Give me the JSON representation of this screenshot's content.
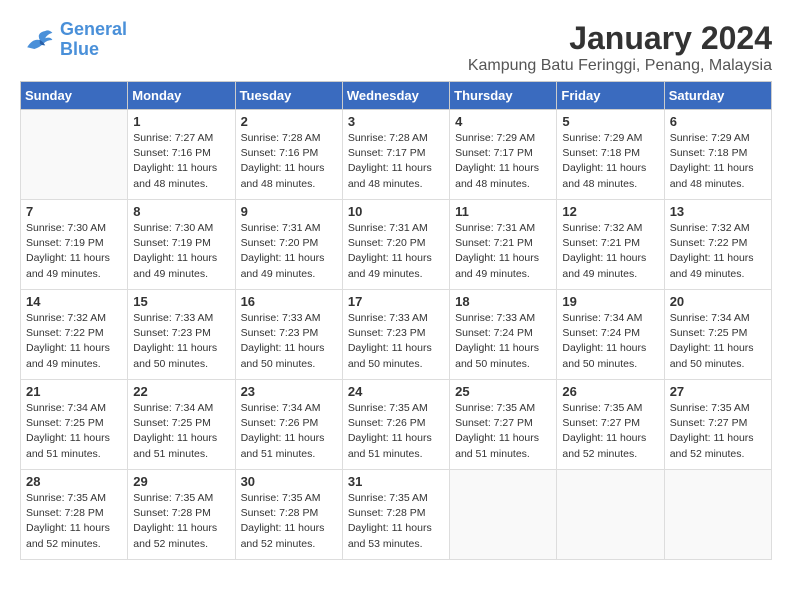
{
  "logo": {
    "text_general": "General",
    "text_blue": "Blue"
  },
  "title": "January 2024",
  "subtitle": "Kampung Batu Feringgi, Penang, Malaysia",
  "days_of_week": [
    "Sunday",
    "Monday",
    "Tuesday",
    "Wednesday",
    "Thursday",
    "Friday",
    "Saturday"
  ],
  "weeks": [
    [
      {
        "day": null
      },
      {
        "day": "1",
        "sunrise": "7:27 AM",
        "sunset": "7:16 PM",
        "daylight": "11 hours and 48 minutes."
      },
      {
        "day": "2",
        "sunrise": "7:28 AM",
        "sunset": "7:16 PM",
        "daylight": "11 hours and 48 minutes."
      },
      {
        "day": "3",
        "sunrise": "7:28 AM",
        "sunset": "7:17 PM",
        "daylight": "11 hours and 48 minutes."
      },
      {
        "day": "4",
        "sunrise": "7:29 AM",
        "sunset": "7:17 PM",
        "daylight": "11 hours and 48 minutes."
      },
      {
        "day": "5",
        "sunrise": "7:29 AM",
        "sunset": "7:18 PM",
        "daylight": "11 hours and 48 minutes."
      },
      {
        "day": "6",
        "sunrise": "7:29 AM",
        "sunset": "7:18 PM",
        "daylight": "11 hours and 48 minutes."
      }
    ],
    [
      {
        "day": "7",
        "sunrise": "7:30 AM",
        "sunset": "7:19 PM",
        "daylight": "11 hours and 49 minutes."
      },
      {
        "day": "8",
        "sunrise": "7:30 AM",
        "sunset": "7:19 PM",
        "daylight": "11 hours and 49 minutes."
      },
      {
        "day": "9",
        "sunrise": "7:31 AM",
        "sunset": "7:20 PM",
        "daylight": "11 hours and 49 minutes."
      },
      {
        "day": "10",
        "sunrise": "7:31 AM",
        "sunset": "7:20 PM",
        "daylight": "11 hours and 49 minutes."
      },
      {
        "day": "11",
        "sunrise": "7:31 AM",
        "sunset": "7:21 PM",
        "daylight": "11 hours and 49 minutes."
      },
      {
        "day": "12",
        "sunrise": "7:32 AM",
        "sunset": "7:21 PM",
        "daylight": "11 hours and 49 minutes."
      },
      {
        "day": "13",
        "sunrise": "7:32 AM",
        "sunset": "7:22 PM",
        "daylight": "11 hours and 49 minutes."
      }
    ],
    [
      {
        "day": "14",
        "sunrise": "7:32 AM",
        "sunset": "7:22 PM",
        "daylight": "11 hours and 49 minutes."
      },
      {
        "day": "15",
        "sunrise": "7:33 AM",
        "sunset": "7:23 PM",
        "daylight": "11 hours and 50 minutes."
      },
      {
        "day": "16",
        "sunrise": "7:33 AM",
        "sunset": "7:23 PM",
        "daylight": "11 hours and 50 minutes."
      },
      {
        "day": "17",
        "sunrise": "7:33 AM",
        "sunset": "7:23 PM",
        "daylight": "11 hours and 50 minutes."
      },
      {
        "day": "18",
        "sunrise": "7:33 AM",
        "sunset": "7:24 PM",
        "daylight": "11 hours and 50 minutes."
      },
      {
        "day": "19",
        "sunrise": "7:34 AM",
        "sunset": "7:24 PM",
        "daylight": "11 hours and 50 minutes."
      },
      {
        "day": "20",
        "sunrise": "7:34 AM",
        "sunset": "7:25 PM",
        "daylight": "11 hours and 50 minutes."
      }
    ],
    [
      {
        "day": "21",
        "sunrise": "7:34 AM",
        "sunset": "7:25 PM",
        "daylight": "11 hours and 51 minutes."
      },
      {
        "day": "22",
        "sunrise": "7:34 AM",
        "sunset": "7:25 PM",
        "daylight": "11 hours and 51 minutes."
      },
      {
        "day": "23",
        "sunrise": "7:34 AM",
        "sunset": "7:26 PM",
        "daylight": "11 hours and 51 minutes."
      },
      {
        "day": "24",
        "sunrise": "7:35 AM",
        "sunset": "7:26 PM",
        "daylight": "11 hours and 51 minutes."
      },
      {
        "day": "25",
        "sunrise": "7:35 AM",
        "sunset": "7:27 PM",
        "daylight": "11 hours and 51 minutes."
      },
      {
        "day": "26",
        "sunrise": "7:35 AM",
        "sunset": "7:27 PM",
        "daylight": "11 hours and 52 minutes."
      },
      {
        "day": "27",
        "sunrise": "7:35 AM",
        "sunset": "7:27 PM",
        "daylight": "11 hours and 52 minutes."
      }
    ],
    [
      {
        "day": "28",
        "sunrise": "7:35 AM",
        "sunset": "7:28 PM",
        "daylight": "11 hours and 52 minutes."
      },
      {
        "day": "29",
        "sunrise": "7:35 AM",
        "sunset": "7:28 PM",
        "daylight": "11 hours and 52 minutes."
      },
      {
        "day": "30",
        "sunrise": "7:35 AM",
        "sunset": "7:28 PM",
        "daylight": "11 hours and 52 minutes."
      },
      {
        "day": "31",
        "sunrise": "7:35 AM",
        "sunset": "7:28 PM",
        "daylight": "11 hours and 53 minutes."
      },
      {
        "day": null
      },
      {
        "day": null
      },
      {
        "day": null
      }
    ]
  ]
}
